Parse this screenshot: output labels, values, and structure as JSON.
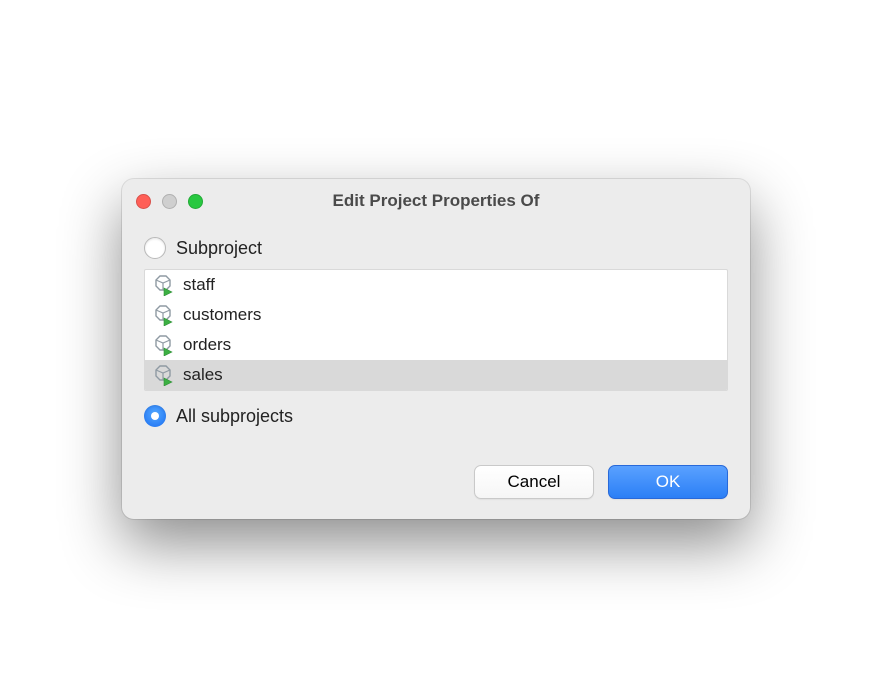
{
  "title": "Edit Project Properties Of",
  "options": {
    "subproject_label": "Subproject",
    "all_label": "All subprojects"
  },
  "items": [
    {
      "label": "staff",
      "selected": false
    },
    {
      "label": "customers",
      "selected": false
    },
    {
      "label": "orders",
      "selected": false
    },
    {
      "label": "sales",
      "selected": true
    }
  ],
  "buttons": {
    "cancel": "Cancel",
    "ok": "OK"
  }
}
